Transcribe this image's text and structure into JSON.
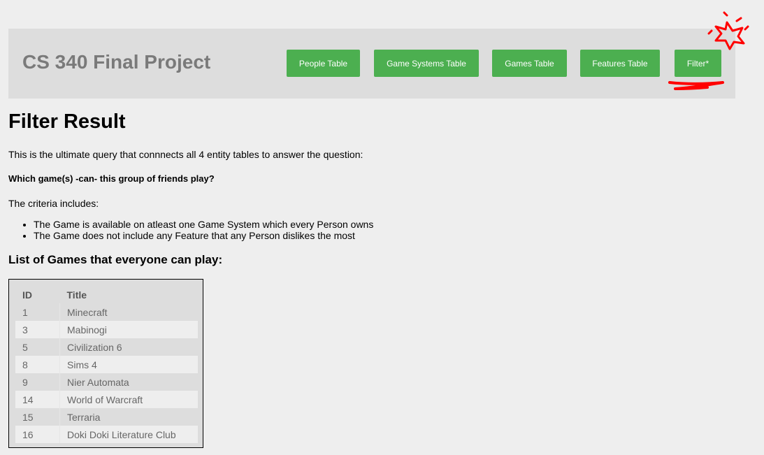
{
  "header": {
    "site_title": "CS 340 Final Project",
    "nav": [
      {
        "label": "People Table"
      },
      {
        "label": "Game Systems Table"
      },
      {
        "label": "Games Table"
      },
      {
        "label": "Features Table"
      },
      {
        "label": "Filter*"
      }
    ],
    "nav_color": "#4caf50"
  },
  "main": {
    "title": "Filter Result",
    "intro": "This is the ultimate query that connnects all 4 entity tables to answer the question:",
    "question": "Which game(s) -can- this group of friends play?",
    "criteria_label": "The criteria includes:",
    "criteria": [
      "The Game is available on atleast one Game System which every Person owns",
      "The Game does not include any Feature that any Person dislikes the most"
    ],
    "list_heading": "List of Games that everyone can play:"
  },
  "table": {
    "headers": {
      "id": "ID",
      "title": "Title"
    },
    "rows": [
      {
        "id": "1",
        "title": "Minecraft"
      },
      {
        "id": "3",
        "title": "Mabinogi"
      },
      {
        "id": "5",
        "title": "Civilization 6"
      },
      {
        "id": "8",
        "title": "Sims 4"
      },
      {
        "id": "9",
        "title": "Nier Automata"
      },
      {
        "id": "14",
        "title": "World of Warcraft"
      },
      {
        "id": "15",
        "title": "Terraria"
      },
      {
        "id": "16",
        "title": "Doki Doki Literature Club"
      }
    ]
  },
  "annotation_color": "#ff0000"
}
